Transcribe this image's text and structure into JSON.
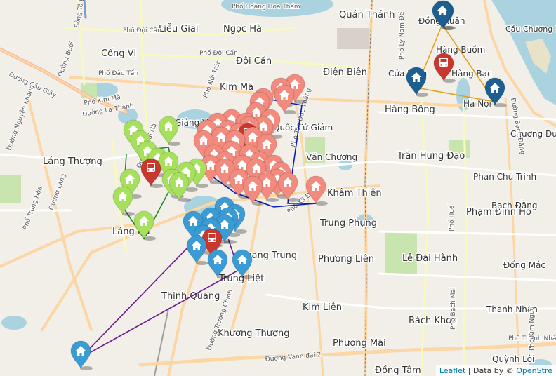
{
  "colors": {
    "red_group": "#f38a7e",
    "green_group": "#a7e05c",
    "blue_group": "#3a9bd5",
    "darkblue_group": "#1d5f91",
    "bus": "#c8382f",
    "water": "#aad3df",
    "park": "#c8e5b0"
  },
  "icons": {
    "house": "home-icon",
    "bus": "bus-icon"
  },
  "attribution": {
    "leaflet": "Leaflet",
    "separator": " | Data by © ",
    "osm": "OpenStre"
  },
  "labels": [
    {
      "text": "Quán Thánh"
    },
    {
      "text": "Đồng Xuân"
    },
    {
      "text": "Ngọc Hà"
    },
    {
      "text": "Liễu Giai"
    },
    {
      "text": "Cống Vị"
    },
    {
      "text": "Đội Cấn"
    },
    {
      "text": "Điện Biên"
    },
    {
      "text": "Hàng Buồm"
    },
    {
      "text": "Cửa Nam"
    },
    {
      "text": "Hàng Bạc"
    },
    {
      "text": "Kim Mã"
    },
    {
      "text": "Hàng Bông"
    },
    {
      "text": "Hà Nội"
    },
    {
      "text": "Giảng Võ"
    },
    {
      "text": "Quốc Tử Giám"
    },
    {
      "text": "Chương Dương"
    },
    {
      "text": "Văn Chương"
    },
    {
      "text": "Trần Hưng Đạo"
    },
    {
      "text": "Láng Thượng"
    },
    {
      "text": "Phan Chu Trinh"
    },
    {
      "text": "Khâm Thiên"
    },
    {
      "text": "Phạm Đình Hổ"
    },
    {
      "text": "Trung Phụng"
    },
    {
      "text": "Láng Hạ"
    },
    {
      "text": "Bạch Đằng"
    },
    {
      "text": "Quang Trung"
    },
    {
      "text": "Phương Liên"
    },
    {
      "text": "Lê Đại Hành"
    },
    {
      "text": "Đống Mác"
    },
    {
      "text": "Trung Liệt"
    },
    {
      "text": "Thịnh Quang"
    },
    {
      "text": "Kim Liên"
    },
    {
      "text": "Thanh Nhàn"
    },
    {
      "text": "Bách Khoa"
    },
    {
      "text": "Khương Thượng"
    },
    {
      "text": "Phương Mai"
    },
    {
      "text": "Quỳnh Lôi"
    },
    {
      "text": "Đồng Tâm"
    },
    {
      "text": "Cầu Chương Dương"
    }
  ],
  "streets": [
    {
      "text": "Phố Đội Cấn"
    },
    {
      "text": "Phố Đội Cấn"
    },
    {
      "text": "Phố Đào Tấn"
    },
    {
      "text": "Đường Bưởi"
    },
    {
      "text": "Phố Kim Mã"
    },
    {
      "text": "Đường La Thành"
    },
    {
      "text": "Đường Cầu Giấy"
    },
    {
      "text": "Đường Nguyễn Khang"
    },
    {
      "text": "Phố Núi Trúc"
    },
    {
      "text": "Phố Tôn Đức Thắng"
    },
    {
      "text": "Phố Xã Đàn"
    },
    {
      "text": "Đường Láng"
    },
    {
      "text": "Phố Trung Hòa"
    },
    {
      "text": "Đường Vành đai 2"
    },
    {
      "text": "Phố Bạch Mai"
    },
    {
      "text": "Phố Huế"
    },
    {
      "text": "Phố Lý Nam Đế"
    },
    {
      "text": "Đường Bạch Đằng"
    },
    {
      "text": "Phố Thanh Nhàn"
    },
    {
      "text": "Phố Kim Ngưu"
    },
    {
      "text": "Phố Hoàng Hoa Thám"
    },
    {
      "text": "Sông Tô Lịch"
    },
    {
      "text": "Đường Thái Hà"
    },
    {
      "text": "Đường Trường Chinh"
    }
  ],
  "routes": [
    {
      "group": "red",
      "color": "#0b1fbf"
    },
    {
      "group": "green",
      "color": "#1f8a1f"
    },
    {
      "group": "blue",
      "color": "#6a1a8f"
    },
    {
      "group": "darkblue",
      "color": "#e2a21c"
    }
  ],
  "markers": {
    "red_houses": 37,
    "green_houses": 13,
    "blue_houses": 13,
    "darkblue_houses": 4,
    "bus_stops": 4
  }
}
